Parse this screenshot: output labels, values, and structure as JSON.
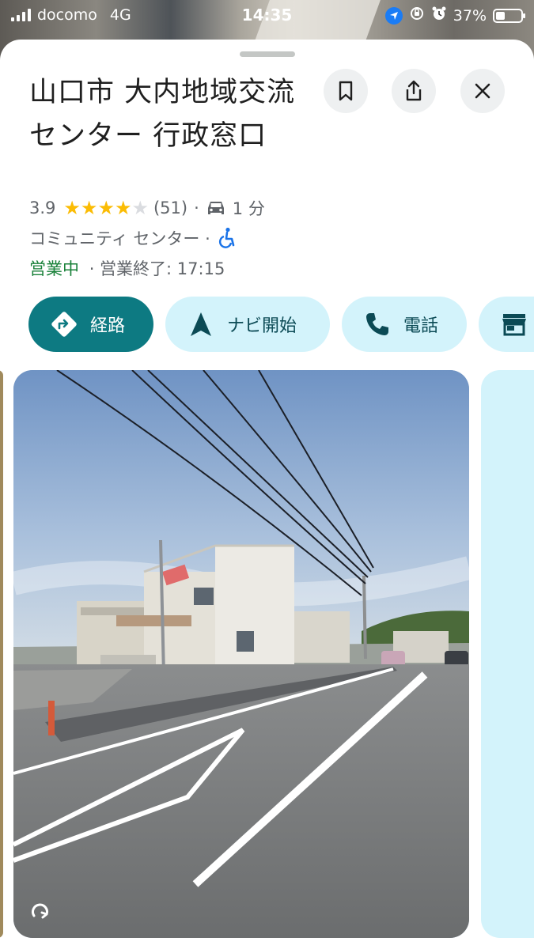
{
  "status_bar": {
    "carrier": "docomo",
    "network": "4G",
    "time": "14:35",
    "battery": "37%",
    "battery_level": 0.37
  },
  "place": {
    "title": "山口市 大内地域交流センター 行政窓口",
    "rating": "3.9",
    "stars_filled": 4,
    "review_count": "(51)",
    "travel_time": "1 分",
    "category": "コミュニティ センター ·",
    "open_status": "営業中",
    "hours": "· 営業終了: 17:15"
  },
  "actions": {
    "directions": "経路",
    "start_navigation": "ナビ開始",
    "call": "電話"
  },
  "colors": {
    "primary": "#0d7a82",
    "chip_bg": "#d3f3fb",
    "open_green": "#188038",
    "star": "#fbbc04",
    "accessible_blue": "#1a73e8"
  },
  "icons": [
    "bookmark-icon",
    "share-icon",
    "close-icon",
    "car-icon",
    "wheelchair-icon",
    "directions-icon",
    "navigation-arrow-icon",
    "phone-icon",
    "store-icon",
    "360-icon"
  ]
}
